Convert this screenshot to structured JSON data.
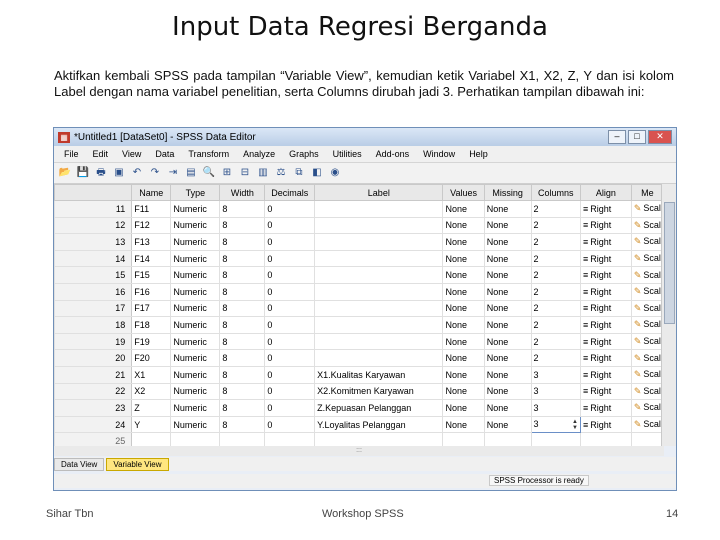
{
  "slide": {
    "title": "Input Data Regresi Berganda",
    "intro": "Aktifkan kembali SPSS pada tampilan “Variable View”, kemudian ketik Variabel X1, X2, Z, Y dan isi kolom Label dengan nama variabel penelitian, serta Columns dirubah jadi 3. Perhatikan tampilan dibawah ini:"
  },
  "window": {
    "title": "*Untitled1 [DataSet0] - SPSS Data Editor",
    "menu": [
      "File",
      "Edit",
      "View",
      "Data",
      "Transform",
      "Analyze",
      "Graphs",
      "Utilities",
      "Add-ons",
      "Window",
      "Help"
    ],
    "toolbar_icons": [
      "open-icon",
      "save-icon",
      "print-icon",
      "dialog-recall-icon",
      "undo-icon",
      "redo-icon",
      "goto-case-icon",
      "variables-icon",
      "find-icon",
      "insert-cases-icon",
      "insert-variable-icon",
      "split-file-icon",
      "weight-cases-icon",
      "select-cases-icon",
      "value-labels-icon",
      "use-sets-icon"
    ]
  },
  "grid": {
    "columns": [
      "Name",
      "Type",
      "Width",
      "Decimals",
      "Label",
      "Values",
      "Missing",
      "Columns",
      "Align",
      "Me"
    ],
    "rows": [
      {
        "num": "11",
        "name": "F11",
        "type": "Numeric",
        "width": "8",
        "decimals": "0",
        "label": "",
        "values": "None",
        "missing": "None",
        "columns": "2",
        "align": "Right",
        "measure": "Scal"
      },
      {
        "num": "12",
        "name": "F12",
        "type": "Numeric",
        "width": "8",
        "decimals": "0",
        "label": "",
        "values": "None",
        "missing": "None",
        "columns": "2",
        "align": "Right",
        "measure": "Scal"
      },
      {
        "num": "13",
        "name": "F13",
        "type": "Numeric",
        "width": "8",
        "decimals": "0",
        "label": "",
        "values": "None",
        "missing": "None",
        "columns": "2",
        "align": "Right",
        "measure": "Scal"
      },
      {
        "num": "14",
        "name": "F14",
        "type": "Numeric",
        "width": "8",
        "decimals": "0",
        "label": "",
        "values": "None",
        "missing": "None",
        "columns": "2",
        "align": "Right",
        "measure": "Scal"
      },
      {
        "num": "15",
        "name": "F15",
        "type": "Numeric",
        "width": "8",
        "decimals": "0",
        "label": "",
        "values": "None",
        "missing": "None",
        "columns": "2",
        "align": "Right",
        "measure": "Scal"
      },
      {
        "num": "16",
        "name": "F16",
        "type": "Numeric",
        "width": "8",
        "decimals": "0",
        "label": "",
        "values": "None",
        "missing": "None",
        "columns": "2",
        "align": "Right",
        "measure": "Scal"
      },
      {
        "num": "17",
        "name": "F17",
        "type": "Numeric",
        "width": "8",
        "decimals": "0",
        "label": "",
        "values": "None",
        "missing": "None",
        "columns": "2",
        "align": "Right",
        "measure": "Scal"
      },
      {
        "num": "18",
        "name": "F18",
        "type": "Numeric",
        "width": "8",
        "decimals": "0",
        "label": "",
        "values": "None",
        "missing": "None",
        "columns": "2",
        "align": "Right",
        "measure": "Scal"
      },
      {
        "num": "19",
        "name": "F19",
        "type": "Numeric",
        "width": "8",
        "decimals": "0",
        "label": "",
        "values": "None",
        "missing": "None",
        "columns": "2",
        "align": "Right",
        "measure": "Scal"
      },
      {
        "num": "20",
        "name": "F20",
        "type": "Numeric",
        "width": "8",
        "decimals": "0",
        "label": "",
        "values": "None",
        "missing": "None",
        "columns": "2",
        "align": "Right",
        "measure": "Scal"
      },
      {
        "num": "21",
        "name": "X1",
        "type": "Numeric",
        "width": "8",
        "decimals": "0",
        "label": "X1.Kualitas Karyawan",
        "values": "None",
        "missing": "None",
        "columns": "3",
        "align": "Right",
        "measure": "Scal"
      },
      {
        "num": "22",
        "name": "X2",
        "type": "Numeric",
        "width": "8",
        "decimals": "0",
        "label": "X2.Komitmen Karyawan",
        "values": "None",
        "missing": "None",
        "columns": "3",
        "align": "Right",
        "measure": "Scal"
      },
      {
        "num": "23",
        "name": "Z",
        "type": "Numeric",
        "width": "8",
        "decimals": "0",
        "label": "Z.Kepuasan Pelanggan",
        "values": "None",
        "missing": "None",
        "columns": "3",
        "align": "Right",
        "measure": "Scal"
      },
      {
        "num": "24",
        "name": "Y",
        "type": "Numeric",
        "width": "8",
        "decimals": "0",
        "label": "Y.Loyalitas Pelanggan",
        "values": "None",
        "missing": "None",
        "columns": "3",
        "align": "Right",
        "measure": "Scal",
        "editing": true
      },
      {
        "num": "25",
        "empty": true
      }
    ]
  },
  "tabs": {
    "data_view": "Data View",
    "variable_view": "Variable View"
  },
  "status": {
    "processor": "SPSS Processor is ready",
    "scroll_hint": ":::"
  },
  "footer": {
    "author": "Sihar Tbn",
    "center": "Workshop SPSS",
    "page": "14"
  },
  "colors": {
    "active_tab": "#ffe680",
    "titlebar": "#b9cde6",
    "close_button": "#d9534f"
  }
}
